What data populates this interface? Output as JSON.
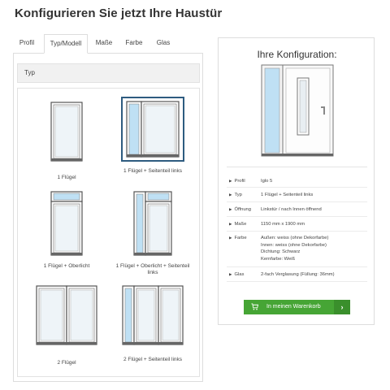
{
  "page_title": "Konfigurieren Sie jetzt Ihre Haustür",
  "tabs": [
    {
      "label": "Profil",
      "active": false
    },
    {
      "label": "Typ/Modell",
      "active": true
    },
    {
      "label": "Maße",
      "active": false
    },
    {
      "label": "Farbe",
      "active": false
    },
    {
      "label": "Glas",
      "active": false
    }
  ],
  "section_header": "Typ",
  "options": [
    {
      "label": "1 Flügel",
      "selected": false
    },
    {
      "label": "1 Flügel + Seitenteil links",
      "selected": true
    },
    {
      "label": "1 Flügel + Oberlicht",
      "selected": false
    },
    {
      "label": "1 Flügel + Oberlicht + Seitenteil links",
      "selected": false
    },
    {
      "label": "2 Flügel",
      "selected": false
    },
    {
      "label": "2 Flügel + Seitenteil links",
      "selected": false
    }
  ],
  "config": {
    "title": "Ihre Konfiguration:",
    "specs": [
      {
        "key": "Profil",
        "value": "Iglo 5"
      },
      {
        "key": "Typ",
        "value": "1 Flügel + Seitenteil links"
      },
      {
        "key": "Öffnung",
        "value": "Linkstür / nach Innen öffnend"
      },
      {
        "key": "Maße",
        "value": "1150 mm x 1900 mm"
      },
      {
        "key": "Farbe",
        "value": "Außen: weiss (ohne Dekorfarbe)\nInnen: weiss (ohne Dekorfarbe)\nDichtung: Schwarz\nKernfarbe: Weiß"
      },
      {
        "key": "Glas",
        "value": "2-fach Verglasung (Füllung: 36mm)"
      }
    ],
    "cart_label": "In meinen Warenkorb"
  },
  "colors": {
    "accent_green": "#46a535",
    "selected_border": "#2e5c80",
    "glass_blue": "#bfe0f4"
  },
  "icons": [
    "cart-icon",
    "chevron-right-icon",
    "triangle-right-icon"
  ]
}
